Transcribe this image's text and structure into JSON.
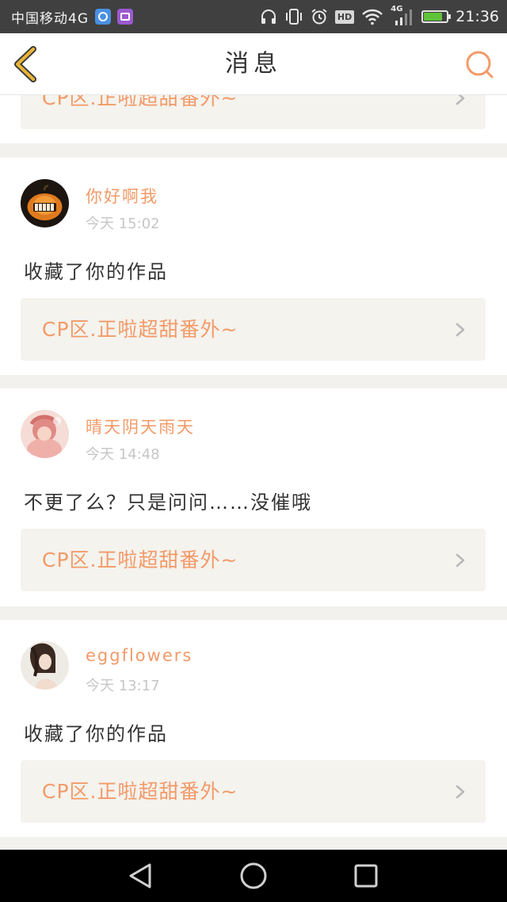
{
  "status_bar": {
    "carrier": "中国移动4G",
    "network_badge": "4G",
    "hd_label": "HD",
    "time": "21:36",
    "battery_level": 0.82,
    "icons": [
      "k-app-icon",
      "gallery-app-icon",
      "headphones-icon",
      "vibrate-icon",
      "alarm-icon",
      "hd-icon",
      "wifi-icon",
      "signal-icon",
      "battery-icon"
    ]
  },
  "header": {
    "title": "消息",
    "back_icon": "chevron-left-icon",
    "search_icon": "search-icon"
  },
  "feed": {
    "partial_item": {
      "work_title": "CP区.正啦超甜番外~"
    },
    "items": [
      {
        "username": "你好啊我",
        "time": "今天 15:02",
        "message": "收藏了你的作品",
        "work_title": "CP区.正啦超甜番外~"
      },
      {
        "username": "晴天阴天雨天",
        "time": "今天 14:48",
        "message": "不更了么？只是问问……没催哦",
        "work_title": "CP区.正啦超甜番外~"
      },
      {
        "username": "eggflowers",
        "time": "今天 13:17",
        "message": "收藏了你的作品",
        "work_title": "CP区.正啦超甜番外~"
      }
    ]
  },
  "nav_bar": {
    "icons": [
      "nav-back-icon",
      "nav-home-icon",
      "nav-recent-icon"
    ]
  },
  "colors": {
    "accent": "#f39a68",
    "status_bar_bg": "#404040",
    "page_bg": "#f2f1ee",
    "card_bg": "#ffffff",
    "link_bg": "#f4f3ee",
    "text_primary": "#333333",
    "text_muted": "#c6c6c6",
    "back_icon": "#e8b537",
    "battery_fill": "#5fc33a"
  }
}
